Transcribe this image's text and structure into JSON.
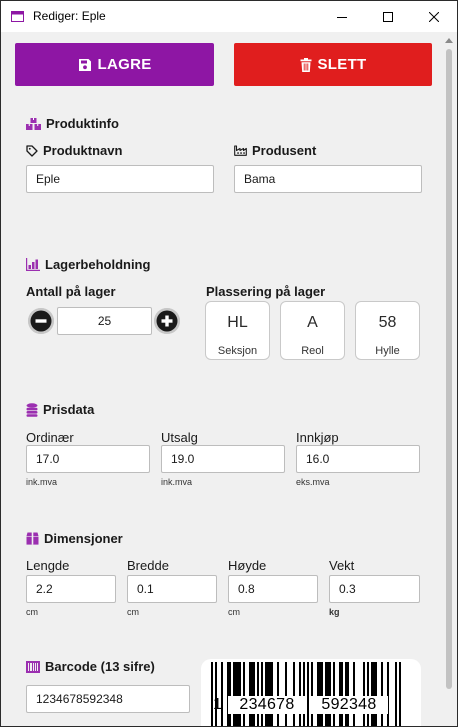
{
  "window": {
    "title": "Rediger: Eple"
  },
  "toolbar": {
    "save_label": "LAGRE",
    "delete_label": "SLETT"
  },
  "produktinfo": {
    "section_title": "Produktinfo",
    "name_label": "Produktnavn",
    "name_value": "Eple",
    "producer_label": "Produsent",
    "producer_value": "Bama"
  },
  "lager": {
    "section_title": "Lagerbeholdning",
    "quantity_label": "Antall på lager",
    "quantity_value": "25",
    "placement_label": "Plassering på lager",
    "placement": [
      {
        "value": "HL",
        "label": "Seksjon"
      },
      {
        "value": "A",
        "label": "Reol"
      },
      {
        "value": "58",
        "label": "Hylle"
      }
    ]
  },
  "prisdata": {
    "section_title": "Prisdata",
    "fields": [
      {
        "label": "Ordinær",
        "value": "17.0",
        "hint": "ink.mva"
      },
      {
        "label": "Utsalg",
        "value": "19.0",
        "hint": "ink.mva"
      },
      {
        "label": "Innkjøp",
        "value": "16.0",
        "hint": "eks.mva"
      }
    ]
  },
  "dimensjoner": {
    "section_title": "Dimensjoner",
    "fields": [
      {
        "label": "Lengde",
        "value": "2.2",
        "unit": "cm"
      },
      {
        "label": "Bredde",
        "value": "0.1",
        "unit": "cm"
      },
      {
        "label": "Høyde",
        "value": "0.8",
        "unit": "cm"
      },
      {
        "label": "Vekt",
        "value": "0.3",
        "unit": "kg"
      }
    ]
  },
  "barcode": {
    "section_title": "Barcode (13 sifre)",
    "value": "1234678592348",
    "human_readable": {
      "first": "1",
      "left": "234678",
      "right": "592348"
    }
  },
  "colors": {
    "save": "#8e16a4",
    "delete": "#e01e1e",
    "section_icon": "#9b2fb0"
  },
  "icons": {
    "app": "window-icon",
    "save": "floppy-disk-icon",
    "delete": "trash-icon",
    "produktinfo": "boxes-icon",
    "produktnavn": "tag-icon",
    "produsent": "industry-icon",
    "lager": "warehouse-chart-icon",
    "prisdata": "coins-icon",
    "dimensjoner": "box-icon",
    "barcode": "barcode-icon"
  }
}
